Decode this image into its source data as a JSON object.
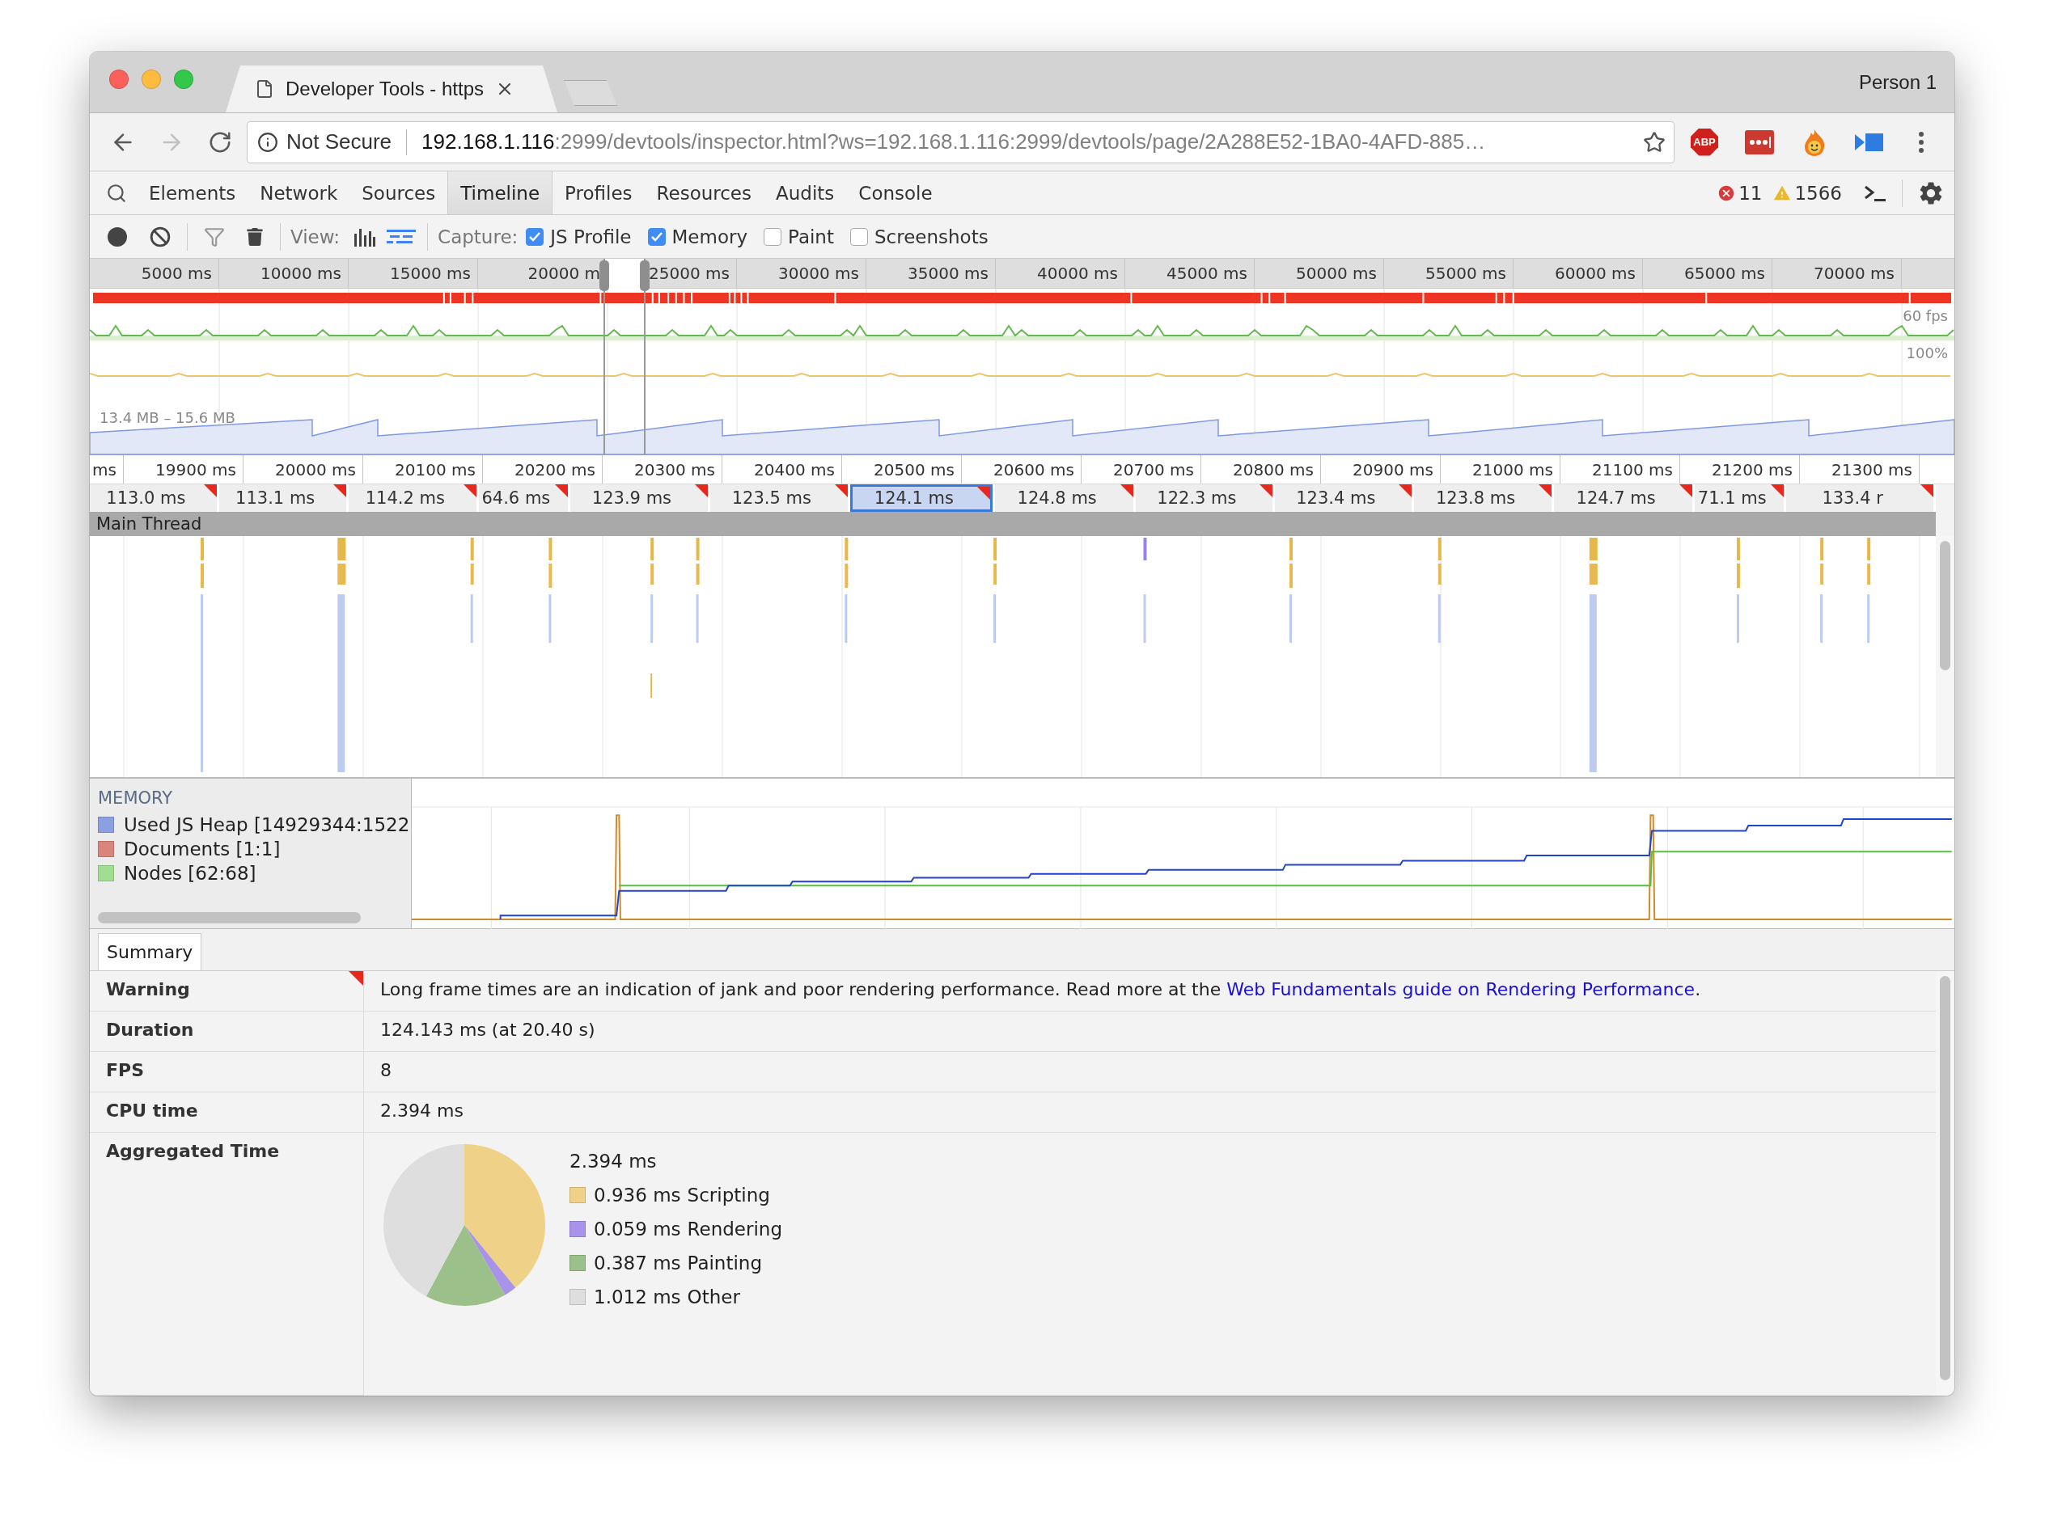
{
  "browser": {
    "tab_title": "Developer Tools - https",
    "profile": "Person 1",
    "security_label": "Not Secure",
    "url_host": "192.168.1.116",
    "url_rest": ":2999/devtools/inspector.html?ws=192.168.1.116:2999/devtools/page/2A288E52-1BA0-4AFD-885…",
    "extensions": [
      {
        "kind": "abp",
        "label": "ABP"
      },
      {
        "kind": "lastpass"
      },
      {
        "kind": "hola"
      },
      {
        "kind": "cast"
      }
    ]
  },
  "devtools_tabs": [
    {
      "label": "Elements",
      "selected": false
    },
    {
      "label": "Network",
      "selected": false
    },
    {
      "label": "Sources",
      "selected": false
    },
    {
      "label": "Timeline",
      "selected": true
    },
    {
      "label": "Profiles",
      "selected": false
    },
    {
      "label": "Resources",
      "selected": false
    },
    {
      "label": "Audits",
      "selected": false
    },
    {
      "label": "Console",
      "selected": false
    }
  ],
  "status": {
    "errors": "11",
    "warnings": "1566"
  },
  "toolbar": {
    "view_label": "View:",
    "view_modes": [
      {
        "kind": "bars",
        "selected": false
      },
      {
        "kind": "flame",
        "selected": true
      }
    ],
    "capture_label": "Capture:",
    "capture_options": [
      {
        "label": "JS Profile",
        "checked": true
      },
      {
        "label": "Memory",
        "checked": true
      },
      {
        "label": "Paint",
        "checked": false
      },
      {
        "label": "Screenshots",
        "checked": false
      }
    ]
  },
  "overview": {
    "ticks": [
      "5000 ms",
      "10000 ms",
      "15000 ms",
      "20000 m",
      "25000 ms",
      "30000 ms",
      "35000 ms",
      "40000 ms",
      "45000 ms",
      "50000 ms",
      "55000 ms",
      "60000 ms",
      "65000 ms",
      "70000 ms"
    ],
    "fps_label": "60 fps",
    "cpu_label": "100%",
    "memory_range": "13.4 MB – 15.6 MB"
  },
  "flame": {
    "ticks": [
      "ms",
      "19900 ms",
      "20000 ms",
      "20100 ms",
      "20200 ms",
      "20300 ms",
      "20400 ms",
      "20500 ms",
      "20600 ms",
      "20700 ms",
      "20800 ms",
      "20900 ms",
      "21000 ms",
      "21100 ms",
      "21200 ms",
      "21300 ms"
    ],
    "frames": [
      {
        "label": "113.0 ms",
        "selected": false
      },
      {
        "label": "113.1 ms",
        "selected": false
      },
      {
        "label": "114.2 ms",
        "selected": false
      },
      {
        "label": "64.6 ms",
        "selected": false
      },
      {
        "label": "123.9 ms",
        "selected": false
      },
      {
        "label": "123.5 ms",
        "selected": false
      },
      {
        "label": "124.1 ms",
        "selected": true
      },
      {
        "label": "124.8 ms",
        "selected": false
      },
      {
        "label": "122.3 ms",
        "selected": false
      },
      {
        "label": "123.4 ms",
        "selected": false
      },
      {
        "label": "123.8 ms",
        "selected": false
      },
      {
        "label": "124.7 ms",
        "selected": false
      },
      {
        "label": "71.1 ms",
        "selected": false
      },
      {
        "label": "133.4 r",
        "selected": false
      }
    ],
    "track_title": "Main Thread"
  },
  "memory": {
    "title": "MEMORY",
    "counters": [
      {
        "label": "Used JS Heap [14929344:1522",
        "color": "#8c9fe0"
      },
      {
        "label": "Documents [1:1]",
        "color": "#d9857c"
      },
      {
        "label": "Nodes [62:68]",
        "color": "#a2de92"
      }
    ]
  },
  "summary": {
    "tab": "Summary",
    "rows": [
      {
        "kind": "warning",
        "label": "Warning",
        "text": "Long frame times are an indication of jank and poor rendering performance. Read more at the ",
        "link": "Web Fundamentals guide on Rendering Performance",
        "after": "."
      },
      {
        "kind": "text",
        "label": "Duration",
        "value": "124.143 ms (at 20.40 s)"
      },
      {
        "kind": "text",
        "label": "FPS",
        "value": "8"
      },
      {
        "kind": "text",
        "label": "CPU time",
        "value": "2.394 ms"
      },
      {
        "kind": "pie",
        "label": "Aggregated Time",
        "total": "2.394 ms",
        "legend": [
          {
            "value": "0.936 ms",
            "color": "#efd288"
          },
          {
            "value": "0.059 ms",
            "color": "#a892ea"
          },
          {
            "value": "0.387 ms",
            "color": "#9cc08a"
          },
          {
            "value": "1.012 ms",
            "color": "#dedede"
          }
        ],
        "chart_data": {
          "type": "pie",
          "categories": [
            "Scripting",
            "Rendering",
            "Painting",
            "Other"
          ],
          "values": [
            39.1,
            2.5,
            16.2,
            42.2
          ]
        }
      }
    ]
  }
}
